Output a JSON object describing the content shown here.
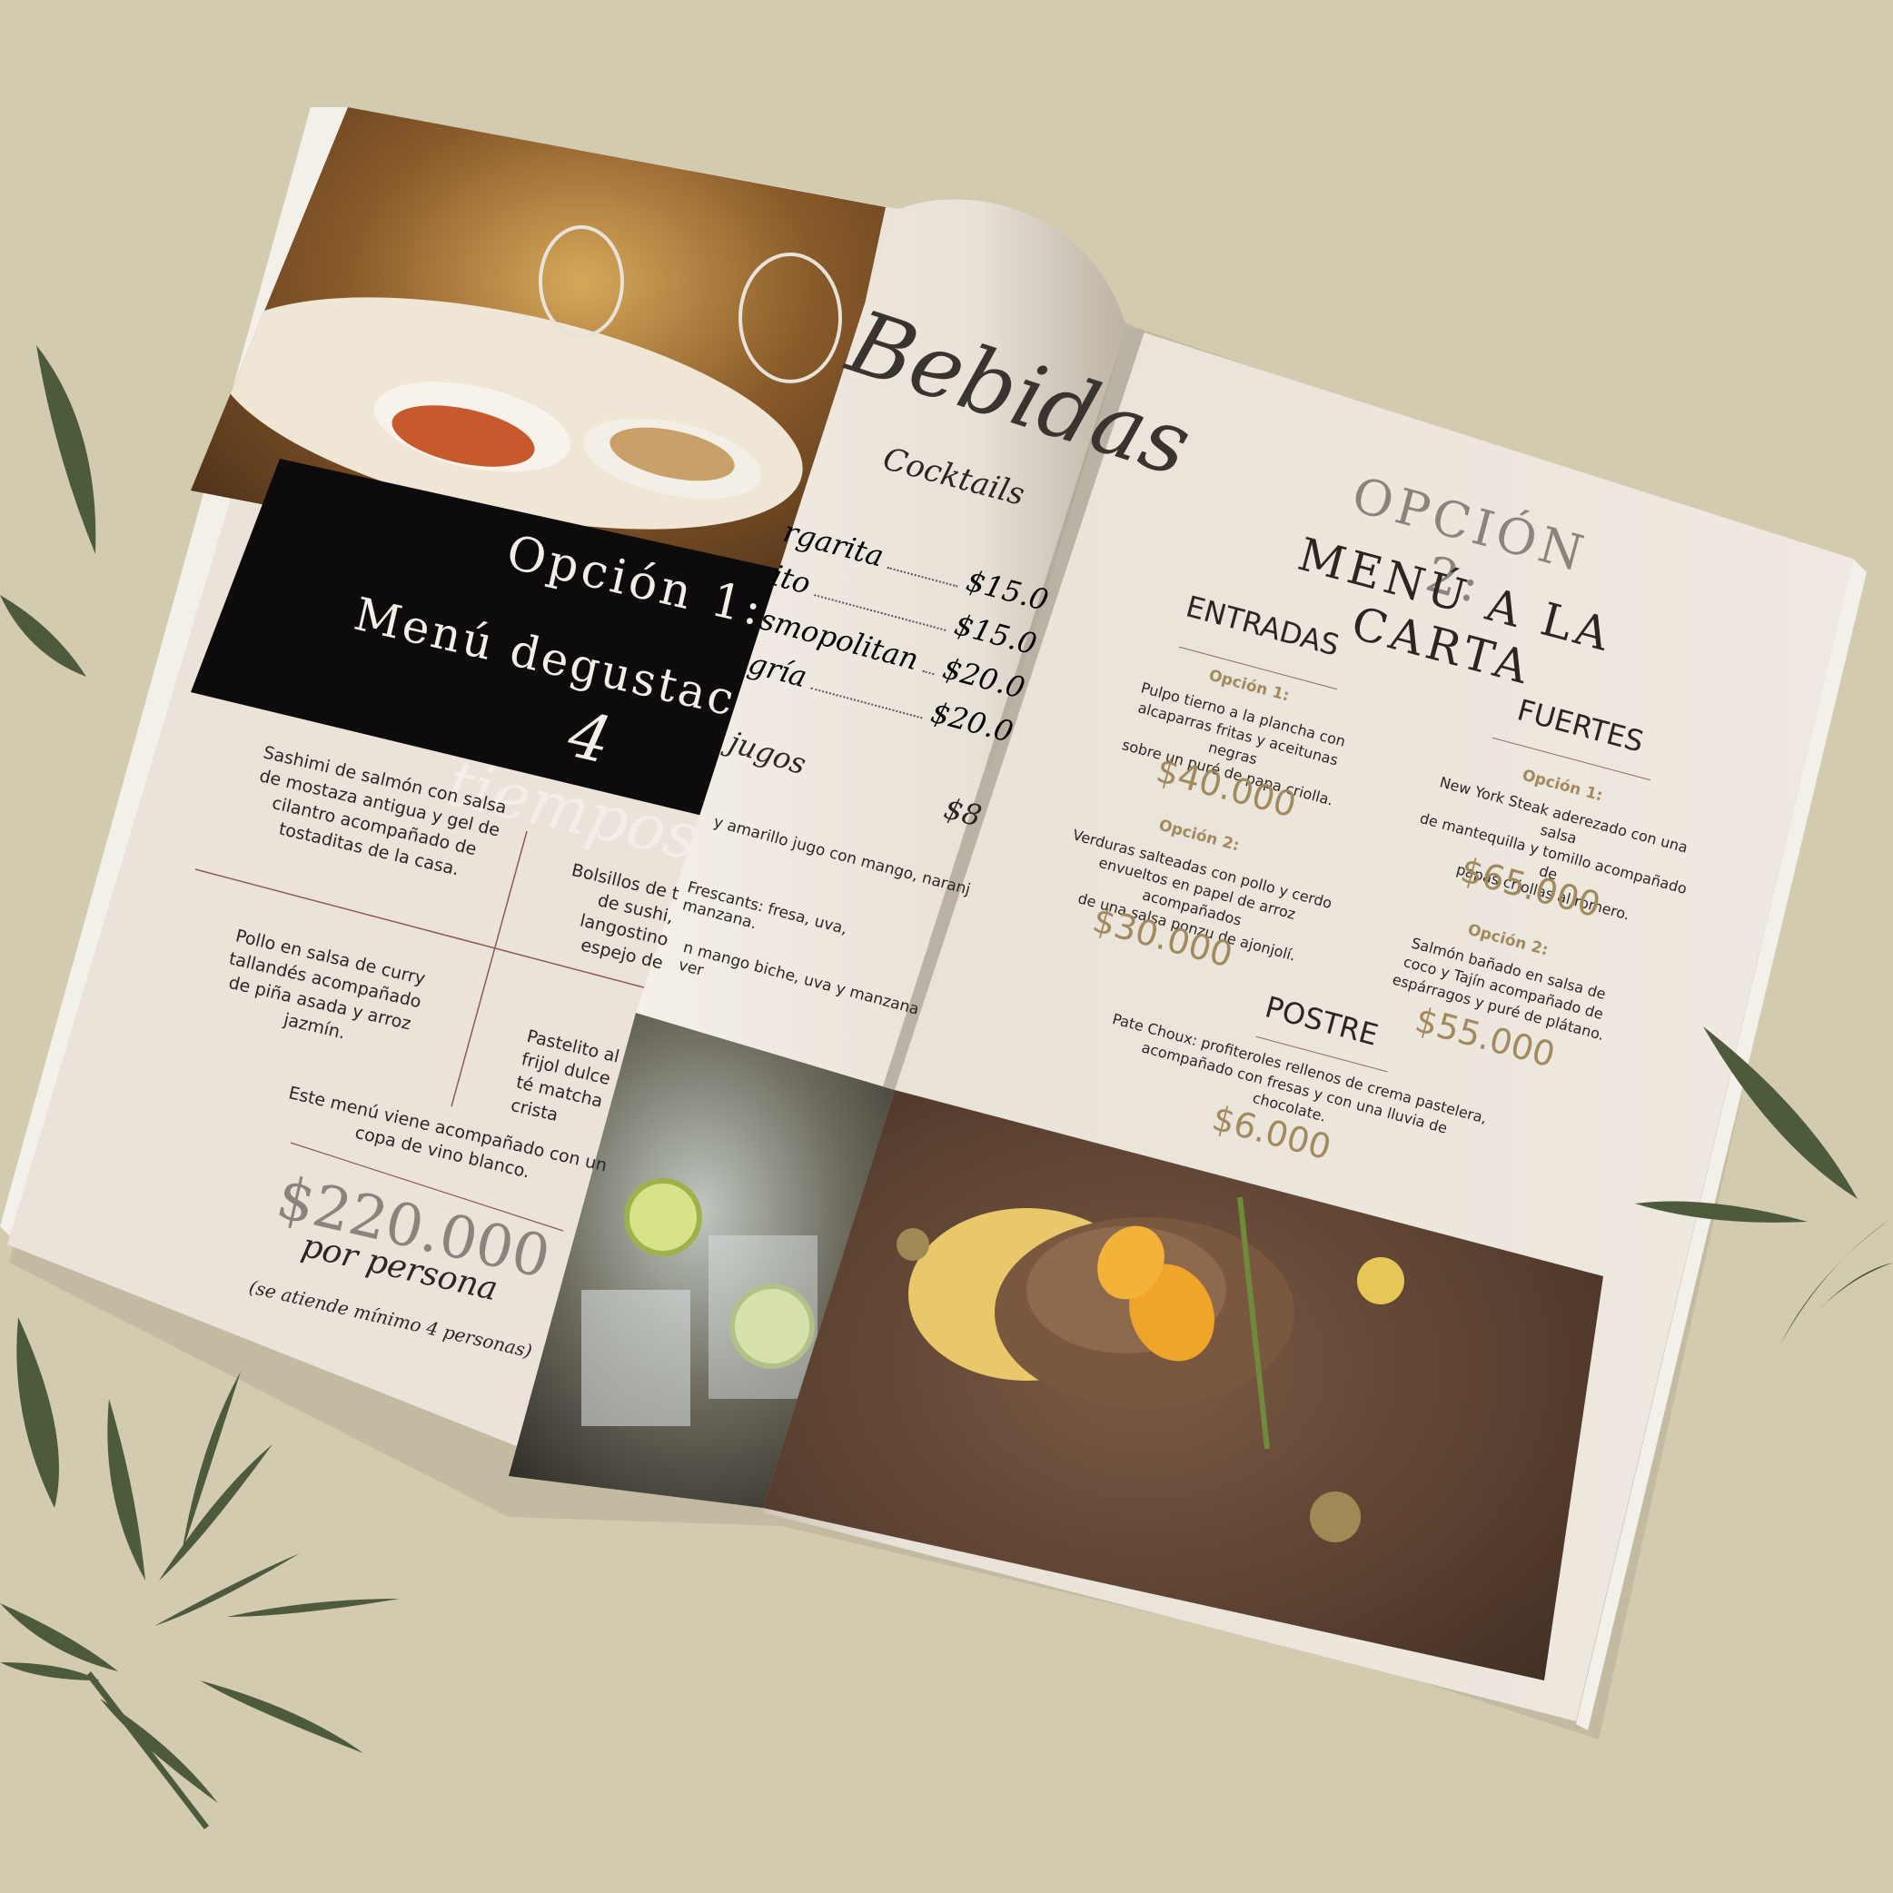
{
  "left_page": {
    "heading_line1": "Opción 1:",
    "heading_line2": "Menú degustac",
    "script_subtitle": "4 tiempos",
    "course_1": "Sashimi de salmón con salsa\nde mostaza antigua y gel de\ncilantro acompañado de\ntostaditas de la casa.",
    "course_2": "Bolsillos de t\nde sushi,\nlangostino\nespejo de",
    "course_3": "Pollo en salsa de curry\ntallandés acompañado\nde piña asada y arroz\njazmín.",
    "course_4": "Pastelito al\nfrijol dulce\nté matcha\ncrista",
    "note": "Este menú viene acompañado con un\ncopa de vino blanco.",
    "price": "$220.000",
    "per_person": "por persona",
    "minimum": "(se atiende mínimo 4 personas)"
  },
  "drinks_page": {
    "script_title": "Bebidas",
    "cocktails_heading": "Cocktails",
    "cocktail_rows": [
      {
        "name": "rgarita",
        "price": "$15.0"
      },
      {
        "name": "ito",
        "price": "$15.0"
      },
      {
        "name": "smopolitan",
        "price": "$20.0"
      },
      {
        "name": "gría",
        "price": "$20.0"
      }
    ],
    "juices_heading": "jugos",
    "juice_price": "$8",
    "juice_lines": [
      "y amarillo jugo con mango, naranj",
      "Frescants: fresa, uva, manzana.",
      "n mango biche, uva y manzana ver"
    ]
  },
  "right_page": {
    "heading_line1": "Opción 2:",
    "heading_line2": "Menú a la carta",
    "entradas_heading": "Entradas",
    "entradas": [
      {
        "label": "Opción 1:",
        "desc": "Pulpo tierno a la plancha con\nalcaparras fritas y aceitunas negras\nsobre un puré de papa criolla.",
        "price": "$40.000"
      },
      {
        "label": "Opción 2:",
        "desc": "Verduras salteadas con pollo y cerdo\nenvueltos en papel de arroz acompañados\nde una salsa ponzu de ajonjolí.",
        "price": "$30.000"
      }
    ],
    "fuertes_heading": "Fuertes",
    "fuertes": [
      {
        "label": "Opción 1:",
        "desc": "New York Steak aderezado con una salsa\nde mantequilla y tomillo acompañado de\npapas criollas al romero.",
        "price": "$65.000"
      },
      {
        "label": "Opción 2:",
        "desc": "Salmón bañado en salsa de\ncoco y Tajín acompañado de\nespárragos y puré de plátano.",
        "price": "$55.000"
      }
    ],
    "postre_heading": "Postre",
    "postre_desc": "Pate Choux: profiteroles rellenos de crema pastelera,\nacompañado con fresas y con una lluvia de chocolate.",
    "postre_price": "$6.000"
  },
  "colors": {
    "background": "#d3cbb0",
    "page": "#ece5dc",
    "black_band": "#0d0b0b",
    "gold": "#a08a5e",
    "leaf": "#4d5a3c"
  }
}
